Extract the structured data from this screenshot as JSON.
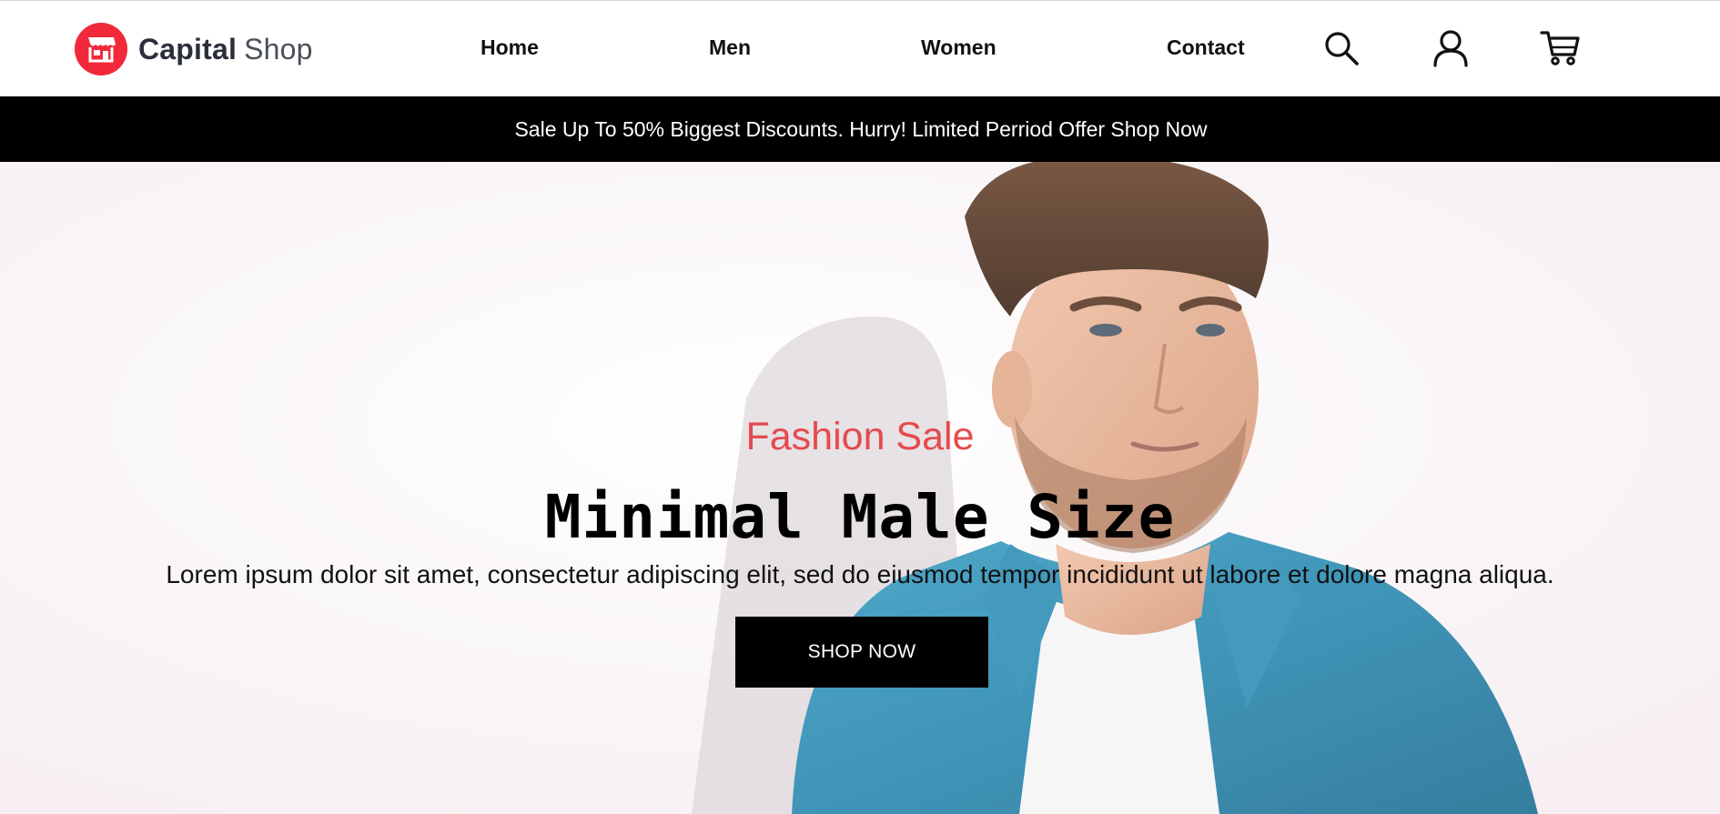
{
  "brand": {
    "name_bold": "Capital",
    "name_light": "Shop",
    "logo_icon": "storefront-icon",
    "color": "#f2293a"
  },
  "nav": {
    "items": [
      {
        "label": "Home"
      },
      {
        "label": "Men"
      },
      {
        "label": "Women"
      },
      {
        "label": "Contact"
      }
    ]
  },
  "header_icons": {
    "search": "search-icon",
    "account": "user-icon",
    "cart": "cart-icon"
  },
  "promo": {
    "text": "Sale Up To 50% Biggest Discounts. Hurry! Limited Perriod Offer Shop Now",
    "background": "#000000"
  },
  "hero": {
    "eyebrow": "Fashion Sale",
    "eyebrow_color": "#e64a4f",
    "title": "Minimal Male Size",
    "description": "Lorem ipsum dolor sit amet, consectetur adipiscing elit, sed do eiusmod tempor incididunt ut labore et dolore magna aliqua.",
    "cta_label": "SHOP NOW"
  }
}
